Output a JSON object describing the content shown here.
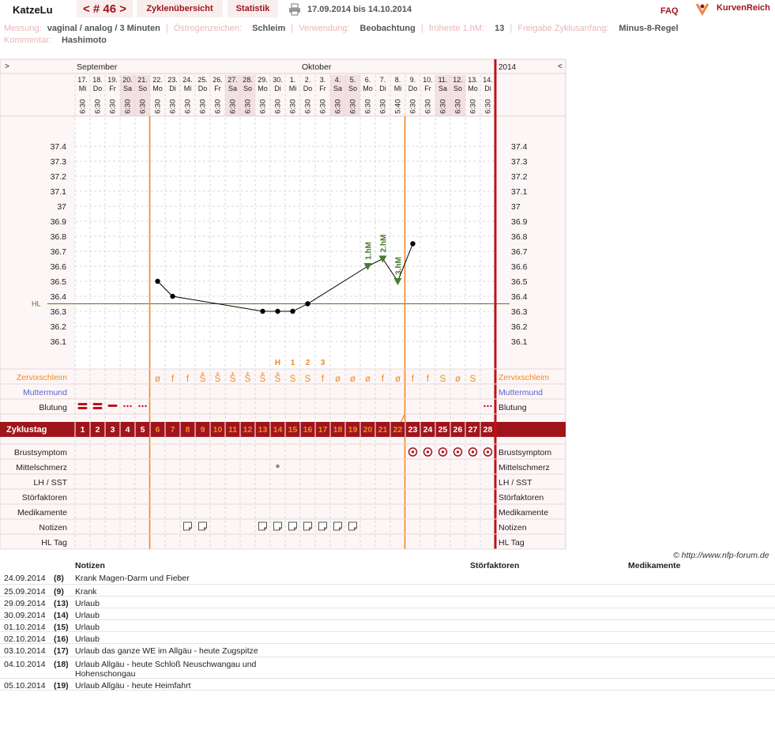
{
  "header": {
    "user": "KatzeLu",
    "cycle_nav": "< # 46 >",
    "tab_overview": "Zyklenübersicht",
    "tab_stats": "Statistik",
    "period": "17.09.2014 bis 14.10.2014",
    "faq": "FAQ",
    "brand": "KurvenReich"
  },
  "meta": {
    "messung_label": "Messung:",
    "messung": "vaginal / analog / 3 Minuten",
    "oestrogen_label": "Östrogenzeichen:",
    "oestrogen": "Schleim",
    "verwendung_label": "Verwendung:",
    "verwendung": "Beobachtung",
    "frueheste_label": "früheste 1.hM:",
    "frueheste": "13",
    "freigabe_label": "Freigabe Zyklusanfang:",
    "freigabe": "Minus-8-Regel",
    "kommentar_label": "Kommentar:",
    "kommentar": "Hashimoto"
  },
  "chart_data": {
    "type": "line",
    "months": [
      {
        "label": "September",
        "day": 1
      },
      {
        "label": "Oktober",
        "day": 16
      }
    ],
    "year": "2014",
    "nav_left": ">",
    "nav_right": "<",
    "dates": [
      "17.",
      "18.",
      "19.",
      "20.",
      "21.",
      "22.",
      "23.",
      "24.",
      "25.",
      "26.",
      "27.",
      "28.",
      "29.",
      "30.",
      "1.",
      "2.",
      "3.",
      "4.",
      "5.",
      "6.",
      "7.",
      "8.",
      "9.",
      "10.",
      "11.",
      "12.",
      "13.",
      "14."
    ],
    "weekdays": [
      "Mi",
      "Do",
      "Fr",
      "Sa",
      "So",
      "Mo",
      "Di",
      "Mi",
      "Do",
      "Fr",
      "Sa",
      "So",
      "Mo",
      "Di",
      "Mi",
      "Do",
      "Fr",
      "Sa",
      "So",
      "Mo",
      "Di",
      "Mi",
      "Do",
      "Fr",
      "Sa",
      "So",
      "Mo",
      "Di"
    ],
    "weekend_days": [
      4,
      5,
      11,
      12,
      18,
      19,
      25,
      26
    ],
    "times": [
      "6:30",
      "6:30",
      "6:30",
      "6:30",
      "6:30",
      "6:30",
      "6:30",
      "6:30",
      "6:30",
      "6:30",
      "6:30",
      "6:30",
      "6:30",
      "6:30",
      "6:30",
      "6:30",
      "6:30",
      "6:30",
      "6:30",
      "6:30",
      "6:30",
      "5:40",
      "6:30",
      "6:30",
      "6:30",
      "6:30",
      "6:30",
      "6:30"
    ],
    "y_ticks": [
      "37.4",
      "37.3",
      "37.2",
      "37.1",
      "37",
      "36.9",
      "36.8",
      "36.7",
      "36.6",
      "36.5",
      "36.4",
      "36.3",
      "36.2",
      "36.1"
    ],
    "ylim": [
      36.0,
      37.5
    ],
    "temps": [
      [
        6,
        36.5
      ],
      [
        7,
        36.4
      ],
      [
        13,
        36.3
      ],
      [
        14,
        36.3
      ],
      [
        15,
        36.3
      ],
      [
        16,
        36.35
      ],
      [
        20,
        36.6
      ],
      [
        21,
        36.65
      ],
      [
        22,
        36.5
      ],
      [
        23,
        36.75
      ]
    ],
    "hl_value": 36.35,
    "hl_label": "HL",
    "hm_markers": [
      {
        "day": 20,
        "label": "1.hM"
      },
      {
        "day": 21,
        "label": "2.hM"
      },
      {
        "day": 22,
        "label": "3.hM"
      }
    ],
    "peak_labels": [
      {
        "day": 14,
        "label": "H"
      },
      {
        "day": 15,
        "label": "1"
      },
      {
        "day": 16,
        "label": "2"
      },
      {
        "day": 17,
        "label": "3"
      }
    ],
    "vlines": [
      6,
      23
    ],
    "zervix": [
      {
        "day": 6,
        "v": "ø"
      },
      {
        "day": 7,
        "v": "f"
      },
      {
        "day": 8,
        "v": "f"
      },
      {
        "day": 9,
        "v": "S",
        "plus": true
      },
      {
        "day": 10,
        "v": "S",
        "plus": true
      },
      {
        "day": 11,
        "v": "S",
        "plus": true
      },
      {
        "day": 12,
        "v": "S",
        "plus": true
      },
      {
        "day": 13,
        "v": "S",
        "plus": true
      },
      {
        "day": 14,
        "v": "S",
        "plus": true
      },
      {
        "day": 15,
        "v": "S"
      },
      {
        "day": 16,
        "v": "S"
      },
      {
        "day": 17,
        "v": "f"
      },
      {
        "day": 18,
        "v": "ø"
      },
      {
        "day": 19,
        "v": "ø"
      },
      {
        "day": 20,
        "v": "ø"
      },
      {
        "day": 21,
        "v": "f"
      },
      {
        "day": 22,
        "v": "ø"
      },
      {
        "day": 23,
        "v": "f"
      },
      {
        "day": 24,
        "v": "f"
      },
      {
        "day": 25,
        "v": "S"
      },
      {
        "day": 26,
        "v": "ø"
      },
      {
        "day": 27,
        "v": "S"
      }
    ],
    "bleeding": [
      {
        "day": 1,
        "level": 3
      },
      {
        "day": 2,
        "level": 3
      },
      {
        "day": 3,
        "level": 2
      },
      {
        "day": 4,
        "level": 1
      },
      {
        "day": 5,
        "level": 1
      },
      {
        "day": 28,
        "level": 1
      }
    ],
    "breast_days": [
      23,
      24,
      25,
      26,
      27,
      28
    ],
    "mittelschmerz_days": [
      14
    ],
    "notes_days": [
      8,
      9,
      13,
      14,
      15,
      16,
      17,
      18,
      19
    ],
    "cycle_days": [
      "1",
      "2",
      "3",
      "4",
      "5",
      "6",
      "7",
      "8",
      "9",
      "10",
      "11",
      "12",
      "13",
      "14",
      "15",
      "16",
      "17",
      "18",
      "19",
      "20",
      "21",
      "22",
      "23",
      "24",
      "25",
      "26",
      "27",
      "28"
    ],
    "infertile_before": 5,
    "infertile_from": 23,
    "labels": {
      "zervix": "Zervixschleim",
      "muttermund": "Muttermund",
      "blutung": "Blutung",
      "zyklustag": "Zyklustag",
      "brust": "Brustsymptom",
      "mittel": "Mittelschmerz",
      "lh": "LH / SST",
      "stoer": "Störfaktoren",
      "medi": "Medikamente",
      "notizen": "Notizen",
      "hltag": "HL Tag"
    },
    "colors": {
      "red": "#a0151c",
      "orange": "#f08a24",
      "green": "#4a7a2e",
      "blue": "#5566cc",
      "grid": "#d8d8d8"
    }
  },
  "copyright": "© http://www.nfp-forum.de",
  "notes_table": {
    "headers": {
      "notizen": "Notizen",
      "stoer": "Störfaktoren",
      "medi": "Medikamente"
    },
    "rows": [
      {
        "date": "24.09.2014",
        "day": "(8)",
        "text": "Krank Magen-Darm und Fieber"
      },
      {
        "date": "25.09.2014",
        "day": "(9)",
        "text": "Krank"
      },
      {
        "date": "29.09.2014",
        "day": "(13)",
        "text": "Urlaub"
      },
      {
        "date": "30.09.2014",
        "day": "(14)",
        "text": "Urlaub"
      },
      {
        "date": "01.10.2014",
        "day": "(15)",
        "text": "Urlaub"
      },
      {
        "date": "02.10.2014",
        "day": "(16)",
        "text": "Urlaub"
      },
      {
        "date": "03.10.2014",
        "day": "(17)",
        "text": "Urlaub das ganze WE im Allgäu - heute Zugspitze"
      },
      {
        "date": "04.10.2014",
        "day": "(18)",
        "text": "Urlaub Allgäu - heute Schloß Neuschwangau und Hohenschongau"
      },
      {
        "date": "05.10.2014",
        "day": "(19)",
        "text": "Urlaub Allgäu - heute Heimfahrt"
      }
    ]
  }
}
